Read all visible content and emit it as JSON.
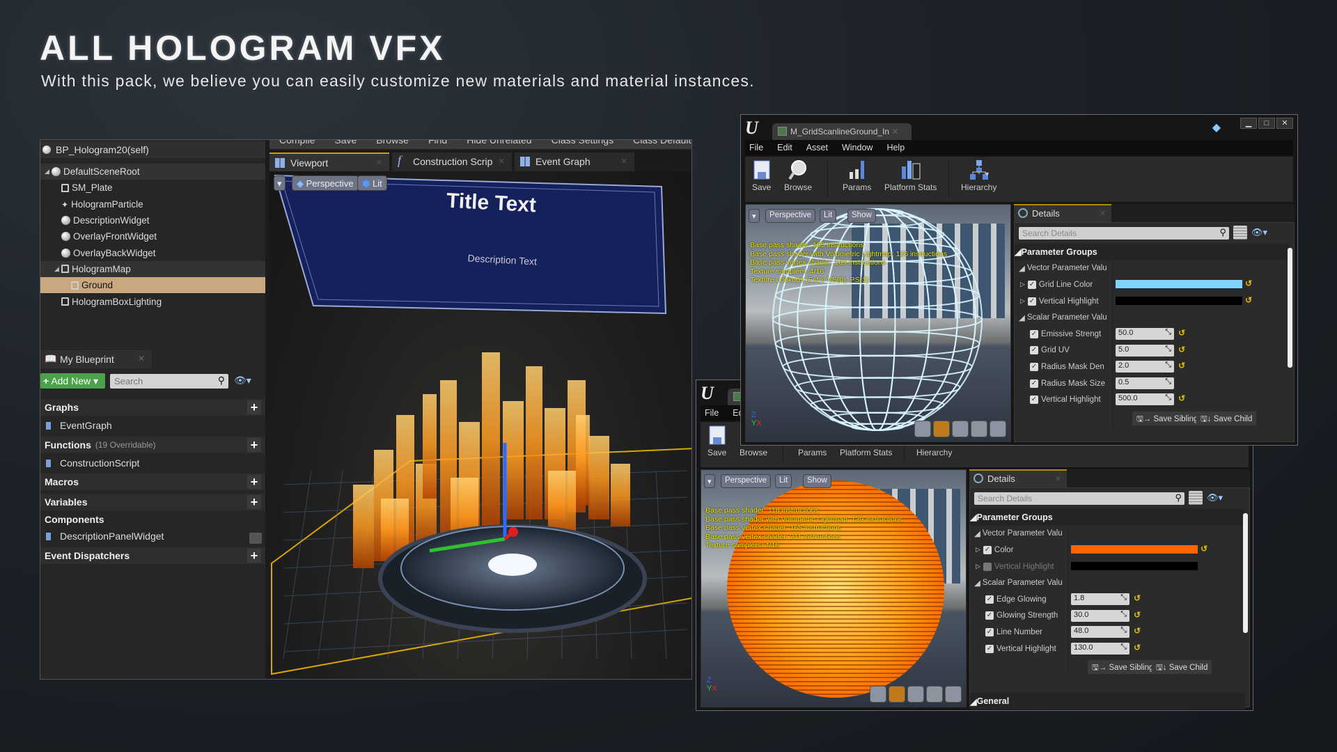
{
  "hero": {
    "title": "ALL HOLOGRAM VFX",
    "subtitle": "With this pack, we believe you can easily customize new materials and material instances."
  },
  "blueprint": {
    "toolbar": [
      "Compile",
      "Save",
      "Browse",
      "Find",
      "Hide Unrelated",
      "Class Settings",
      "Class Defaults"
    ],
    "components": {
      "root": "BP_Hologram20(self)",
      "items": [
        {
          "label": "DefaultSceneRoot",
          "icon": "scene-component-icon",
          "level": 0,
          "expanded": true
        },
        {
          "label": "SM_Plate",
          "icon": "static-mesh-icon",
          "level": 1
        },
        {
          "label": "HologramParticle",
          "icon": "particle-icon",
          "level": 1
        },
        {
          "label": "DescriptionWidget",
          "icon": "widget-component-icon",
          "level": 1
        },
        {
          "label": "OverlayFrontWidget",
          "icon": "widget-component-icon",
          "level": 1
        },
        {
          "label": "OverlayBackWidget",
          "icon": "widget-component-icon",
          "level": 1
        },
        {
          "label": "HologramMap",
          "icon": "static-mesh-icon",
          "level": 1,
          "expanded": true
        },
        {
          "label": "Ground",
          "icon": "static-mesh-icon",
          "level": 2,
          "selected": true
        },
        {
          "label": "HologramBoxLighting",
          "icon": "static-mesh-icon",
          "level": 1
        }
      ]
    },
    "my_blueprint": {
      "tab": "My Blueprint",
      "add_new": "Add New",
      "search_placeholder": "Search",
      "sections": [
        {
          "type": "header",
          "label": "Graphs",
          "note": "",
          "add": true
        },
        {
          "type": "item",
          "label": "EventGraph",
          "icon": "event-graph-icon"
        },
        {
          "type": "header",
          "label": "Functions",
          "note": "(19 Overridable)",
          "add": true
        },
        {
          "type": "item",
          "label": "ConstructionScript",
          "icon": "function-icon"
        },
        {
          "type": "header",
          "label": "Macros",
          "note": "",
          "add": true
        },
        {
          "type": "header",
          "label": "Variables",
          "note": "",
          "add": true
        },
        {
          "type": "subheader",
          "label": "Components",
          "note": "",
          "add": false
        },
        {
          "type": "item",
          "label": "DescriptionPanelWidget",
          "icon": "widget-variable-icon"
        },
        {
          "type": "header",
          "label": "Event Dispatchers",
          "note": "",
          "add": true
        }
      ]
    },
    "tabs": [
      {
        "label": "Viewport",
        "icon": "viewport-icon",
        "active": true
      },
      {
        "label": "Construction Scrip",
        "icon": "function-icon",
        "active": false
      },
      {
        "label": "Event Graph",
        "icon": "event-graph-icon",
        "active": false
      }
    ],
    "viewport": {
      "perspective": "Perspective",
      "lit": "Lit",
      "title_text": "Title Text",
      "description_text": "Description Text"
    }
  },
  "material_windows": [
    {
      "tab_title": "M_GridScanlineGround_In",
      "menu": [
        "File",
        "Edit",
        "Asset",
        "Window",
        "Help"
      ],
      "toolbar": [
        {
          "label": "Save",
          "icon": "save-icon"
        },
        {
          "label": "Browse",
          "icon": "browse-icon"
        },
        {
          "label": "Params",
          "icon": "params-icon"
        },
        {
          "label": "Platform Stats",
          "icon": "platform-stats-icon"
        },
        {
          "label": "Hierarchy",
          "icon": "hierarchy-icon"
        }
      ],
      "viewport": {
        "buttons": [
          "Perspective",
          "Lit",
          "Show"
        ],
        "preview": "grid-sphere",
        "accent": "#bfefff",
        "stats": [
          "Base pass shader: 105 instructions",
          "Base pass shader with Volumetric Lightmap: 126 instructions",
          "Base pass vertex shader: 169 instructions",
          "Texture samplers: 4/16",
          "Texture Lookups (Est.): VS(0), PS(1)"
        ]
      },
      "details": {
        "tab": "Details",
        "search_placeholder": "Search Details",
        "parameter_groups": "Parameter Groups",
        "vector_group": "Vector Parameter Valu",
        "vector_params": [
          {
            "label": "Grid Line Color",
            "checked": true,
            "color": "#7fd4ff",
            "reset": true
          },
          {
            "label": "Vertical Highlight",
            "checked": true,
            "color": "#000000",
            "reset": true
          }
        ],
        "scalar_group": "Scalar Parameter Valu",
        "scalar_params": [
          {
            "label": "Emissive Strengt",
            "value": "50.0",
            "checked": true,
            "reset": true
          },
          {
            "label": "Grid UV",
            "value": "5.0",
            "checked": true,
            "reset": true
          },
          {
            "label": "Radius Mask Den",
            "value": "2.0",
            "checked": true,
            "reset": true
          },
          {
            "label": "Radius Mask Size",
            "value": "0.5",
            "checked": true,
            "reset": false
          },
          {
            "label": "Vertical Highlight",
            "value": "500.0",
            "checked": true,
            "reset": true
          }
        ],
        "save_sibling": "Save Sibling",
        "save_child": "Save Child"
      }
    },
    {
      "tab_title": "",
      "menu": [
        "File",
        "Edit"
      ],
      "toolbar": [
        {
          "label": "Save",
          "icon": "save-icon"
        },
        {
          "label": "Browse",
          "icon": "browse-icon"
        },
        {
          "label": "Params",
          "icon": "params-icon"
        },
        {
          "label": "Platform Stats",
          "icon": "platform-stats-icon"
        },
        {
          "label": "Hierarchy",
          "icon": "hierarchy-icon"
        }
      ],
      "viewport": {
        "buttons": [
          "Perspective",
          "Lit",
          "Show"
        ],
        "preview": "scanline-sphere",
        "accent": "#ff8a00",
        "stats": [
          "Base pass shader: 118 instructions",
          "Base pass shader with Volumetric Lightmap: 139 instructions",
          "Base pass vertex shader: 165 instructions",
          "Base pass vertex shader: 211 instructions",
          "Texture samplers: 4/16"
        ]
      },
      "details": {
        "tab": "Details",
        "search_placeholder": "Search Details",
        "parameter_groups": "Parameter Groups",
        "vector_group": "Vector Parameter Valu",
        "vector_params": [
          {
            "label": "Color",
            "checked": true,
            "color": "#ff6400",
            "reset": true
          },
          {
            "label": "Vertical Highlight",
            "checked": false,
            "color": "#000000",
            "reset": false
          }
        ],
        "scalar_group": "Scalar Parameter Valu",
        "scalar_params": [
          {
            "label": "Edge Glowing",
            "value": "1.8",
            "checked": true,
            "reset": true
          },
          {
            "label": "Glowing Strength",
            "value": "30.0",
            "checked": true,
            "reset": true
          },
          {
            "label": "Line Number",
            "value": "48.0",
            "checked": true,
            "reset": true
          },
          {
            "label": "Vertical Highlight",
            "value": "130.0",
            "checked": true,
            "reset": true
          }
        ],
        "save_sibling": "Save Sibling",
        "save_child": "Save Child",
        "general": "General"
      }
    }
  ]
}
